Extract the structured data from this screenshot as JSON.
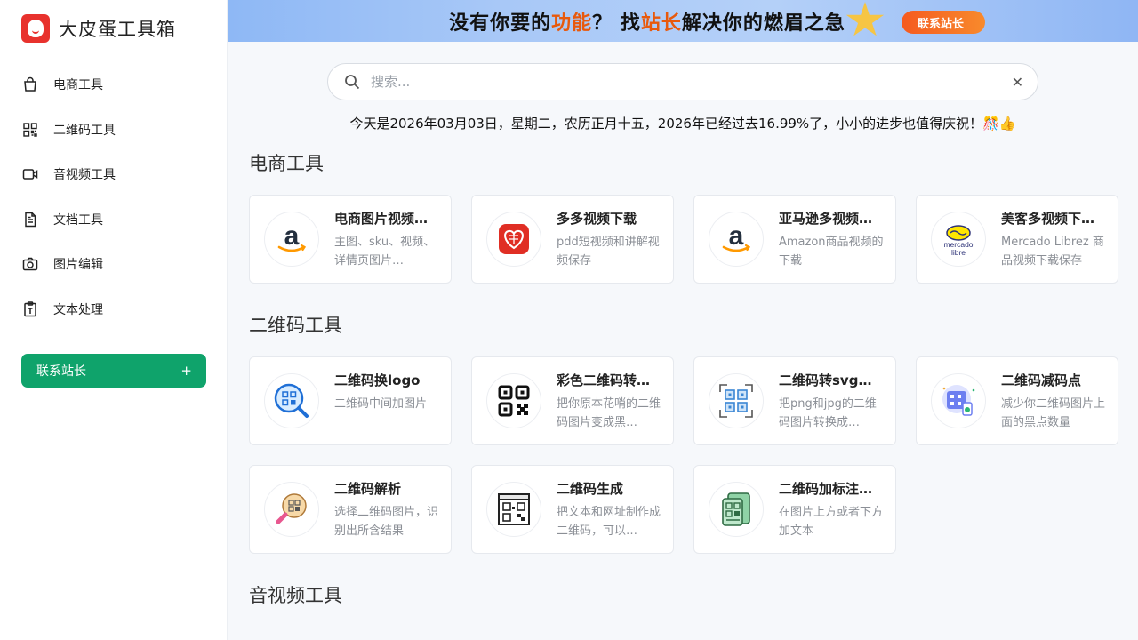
{
  "brand": {
    "title": "大皮蛋工具箱",
    "logo_icon": "egg-face-logo"
  },
  "sidebar": {
    "items": [
      {
        "label": "电商工具",
        "icon": "shopping-bag-icon"
      },
      {
        "label": "二维码工具",
        "icon": "qrcode-icon"
      },
      {
        "label": "音视频工具",
        "icon": "video-camera-icon"
      },
      {
        "label": "文档工具",
        "icon": "document-icon"
      },
      {
        "label": "图片编辑",
        "icon": "camera-icon"
      },
      {
        "label": "文本处理",
        "icon": "text-clipboard-icon"
      }
    ],
    "contact_label": "联系站长",
    "contact_plus": "+"
  },
  "banner": {
    "part1": "没有你要的",
    "hl1": "功能",
    "part2": "？ 找",
    "hl2": "站长",
    "part3": "解决你的燃眉之急",
    "button": "联系站长"
  },
  "search": {
    "placeholder": "搜索...",
    "value": "",
    "clear": "✕"
  },
  "date_line": "今天是2026年03月03日，星期二，农历正月十五，2026年已经过去16.99%了，小小的进步也值得庆祝！🎊👍",
  "sections": [
    {
      "title": "电商工具",
      "cards": [
        {
          "title": "电商图片视频…",
          "desc": "主图、sku、视频、详情页图片…",
          "icon": "amazon-icon"
        },
        {
          "title": "多多视频下载",
          "desc": "pdd短视频和讲解视频保存",
          "icon": "pinduoduo-icon"
        },
        {
          "title": "亚马逊多视频…",
          "desc": "Amazon商品视频的下载",
          "icon": "amazon-icon"
        },
        {
          "title": "美客多视频下…",
          "desc": "Mercado Librez 商品视频下载保存",
          "icon": "mercadolibre-icon",
          "logo_text": "mercado libre"
        }
      ]
    },
    {
      "title": "二维码工具",
      "cards": [
        {
          "title": "二维码换logo",
          "desc": "二维码中间加图片",
          "icon": "qr-magnifier-icon"
        },
        {
          "title": "彩色二维码转…",
          "desc": "把你原本花哨的二维码图片变成黑…",
          "icon": "qr-black-icon"
        },
        {
          "title": "二维码转svg…",
          "desc": "把png和jpg的二维码图片转换成…",
          "icon": "qr-scan-frame-icon"
        },
        {
          "title": "二维码减码点",
          "desc": "减少你二维码图片上面的黑点数量",
          "icon": "qr-reduce-icon"
        },
        {
          "title": "二维码解析",
          "desc": "选择二维码图片，识别出所含结果",
          "icon": "qr-decode-icon"
        },
        {
          "title": "二维码生成",
          "desc": "把文本和网址制作成二维码，可以…",
          "icon": "qr-generate-icon"
        },
        {
          "title": "二维码加标注…",
          "desc": "在图片上方或者下方加文本",
          "icon": "qr-annotate-icon"
        }
      ]
    },
    {
      "title": "音视频工具",
      "cards": []
    }
  ]
}
